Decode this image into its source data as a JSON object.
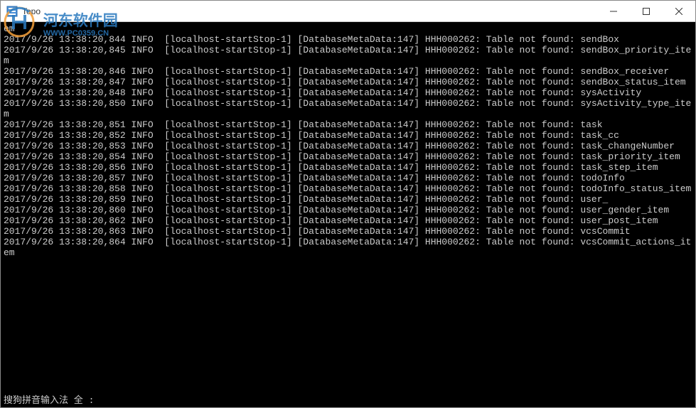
{
  "window": {
    "title": "Topo",
    "minimize": "—",
    "maximize": "☐",
    "close": "✕"
  },
  "watermark": {
    "cn": "河东软件园",
    "url": "WWW.PC0359.CN"
  },
  "log_prefix": {
    "thread": "[localhost-startStop-1]",
    "logger": "[DatabaseMetaData:147]",
    "code": "HHH000262:",
    "msg": "Table not found:"
  },
  "logs": [
    {
      "ts": "",
      "lvl": "",
      "table": "",
      "raw": "em"
    },
    {
      "ts": "2017/9/26 13:38:20,844",
      "lvl": "INFO",
      "table": "sendBox"
    },
    {
      "ts": "2017/9/26 13:38:20,845",
      "lvl": "INFO",
      "table": "sendBox_priority_item"
    },
    {
      "ts": "2017/9/26 13:38:20,846",
      "lvl": "INFO",
      "table": "sendBox_receiver"
    },
    {
      "ts": "2017/9/26 13:38:20,847",
      "lvl": "INFO",
      "table": "sendBox_status_item"
    },
    {
      "ts": "2017/9/26 13:38:20,848",
      "lvl": "INFO",
      "table": "sysActivity"
    },
    {
      "ts": "2017/9/26 13:38:20,850",
      "lvl": "INFO",
      "table": "sysActivity_type_item"
    },
    {
      "ts": "2017/9/26 13:38:20,851",
      "lvl": "INFO",
      "table": "task"
    },
    {
      "ts": "2017/9/26 13:38:20,852",
      "lvl": "INFO",
      "table": "task_cc"
    },
    {
      "ts": "2017/9/26 13:38:20,853",
      "lvl": "INFO",
      "table": "task_changeNumber"
    },
    {
      "ts": "2017/9/26 13:38:20,854",
      "lvl": "INFO",
      "table": "task_priority_item"
    },
    {
      "ts": "2017/9/26 13:38:20,856",
      "lvl": "INFO",
      "table": "task_step_item"
    },
    {
      "ts": "2017/9/26 13:38:20,857",
      "lvl": "INFO",
      "table": "todoInfo"
    },
    {
      "ts": "2017/9/26 13:38:20,858",
      "lvl": "INFO",
      "table": "todoInfo_status_item"
    },
    {
      "ts": "2017/9/26 13:38:20,859",
      "lvl": "INFO",
      "table": "user_"
    },
    {
      "ts": "2017/9/26 13:38:20,860",
      "lvl": "INFO",
      "table": "user_gender_item"
    },
    {
      "ts": "2017/9/26 13:38:20,862",
      "lvl": "INFO",
      "table": "user_post_item"
    },
    {
      "ts": "2017/9/26 13:38:20,863",
      "lvl": "INFO",
      "table": "vcsCommit"
    },
    {
      "ts": "2017/9/26 13:38:20,864",
      "lvl": "INFO",
      "table": "vcsCommit_actions_item"
    }
  ],
  "ime": "搜狗拼音输入法 全 :"
}
